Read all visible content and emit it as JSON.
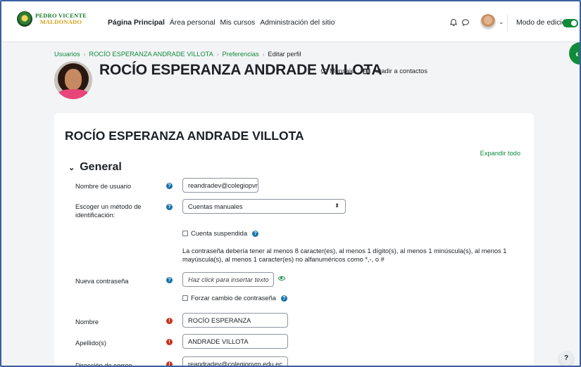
{
  "brand": {
    "line1": "PEDRO VICENTE",
    "line2": "MALDONADO"
  },
  "nav": {
    "items": [
      {
        "label": "Página Principal",
        "active": true
      },
      {
        "label": "Área personal"
      },
      {
        "label": "Mis cursos"
      },
      {
        "label": "Administración del sitio"
      }
    ],
    "edit_mode_label": "Modo de edición",
    "edit_mode_on": true
  },
  "breadcrumb": [
    "Usuarios",
    "ROCÍO ESPERANZA ANDRADE VILLOTA",
    "Preferencias",
    "Editar perfil"
  ],
  "profile": {
    "name": "ROCÍO ESPERANZA ANDRADE VILLOTA",
    "message_label": "Mensaje",
    "add_contact_label": "Añadir a contactos"
  },
  "form": {
    "title": "ROCÍO ESPERANZA ANDRADE VILLOTA",
    "expand_all": "Expandir todo",
    "section_general": "General",
    "username_label": "Nombre de usuario",
    "username_value": "reandradev@colegiopvr",
    "auth_label": "Escoger un método de identificación:",
    "auth_value": "Cuentas manuales",
    "suspended_label": "Cuenta suspendida",
    "password_note": "La contraseña debería tener al menos 8 caracter(es), al menos 1 dígito(s), al menos 1 minúscula(s), al menos 1 mayúscula(s), al menos 1 caracter(es) no alfanuméricos como *,-, o #",
    "new_password_label": "Nueva contraseña",
    "new_password_placeholder": "Haz click para insertar texto",
    "force_change_label": "Forzar cambio de contraseña",
    "firstname_label": "Nombre",
    "firstname_value": "ROCÍO ESPERANZA",
    "lastname_label": "Apellido(s)",
    "lastname_value": "ANDRADE VILLOTA",
    "email_label": "Dirección de correo",
    "email_value": "reandradev@colegiopvm.edu.ec"
  },
  "colors": {
    "accent": "#0f8b3a",
    "help": "#1a73a8",
    "required": "#ca3120"
  },
  "icons": [
    "bell-icon",
    "chat-icon",
    "chevron-down-icon",
    "help-icon",
    "required-icon",
    "eye-icon",
    "pencil-icon",
    "contact-card-icon"
  ]
}
